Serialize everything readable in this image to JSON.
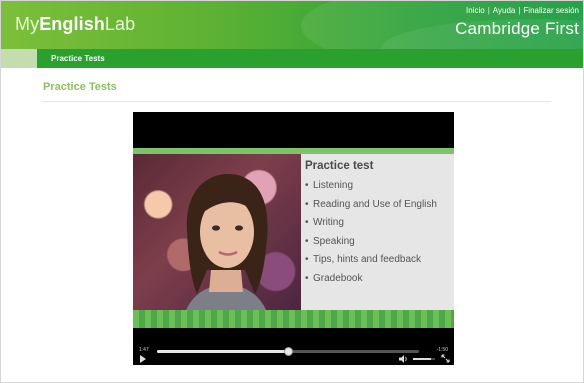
{
  "header": {
    "logo_part1": "My",
    "logo_part2": "English",
    "logo_part3": "Lab",
    "links": [
      "Inicio",
      "Ayuda",
      "Finalizar sesión"
    ],
    "product": "Cambridge First"
  },
  "nav": {
    "active_tab": "Practice Tests"
  },
  "main": {
    "title": "Practice Tests"
  },
  "video": {
    "slide_title": "Practice test",
    "slide_items": [
      "Listening",
      "Reading and Use of English",
      "Writing",
      "Speaking",
      "Tips, hints and feedback",
      "Gradebook"
    ],
    "time_elapsed": "1:47",
    "time_remaining": "-1:50",
    "progress": 0.5,
    "volume": 0.8
  },
  "colors": {
    "brand_green": "#2aa12e",
    "title_green": "#8cbf5e"
  }
}
